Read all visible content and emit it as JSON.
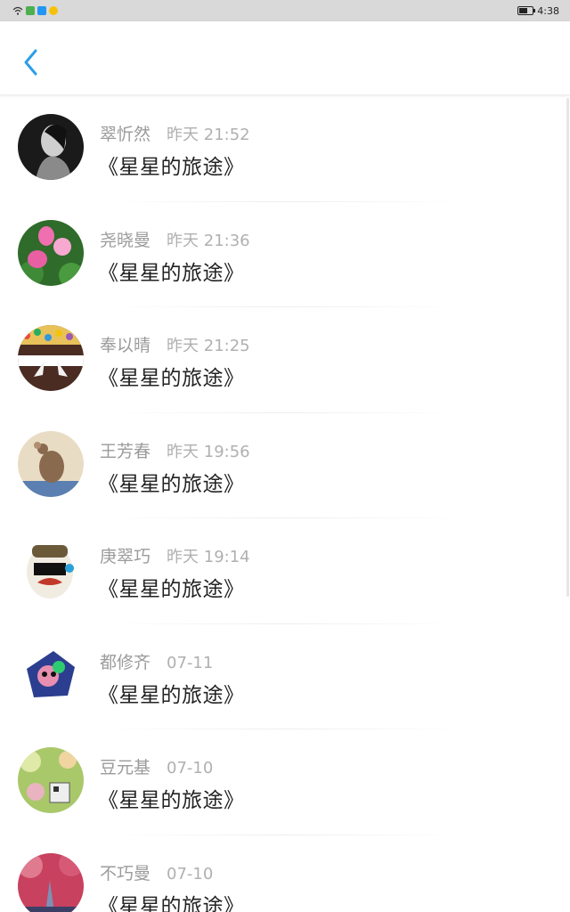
{
  "status_bar": {
    "time": "4:38",
    "icons": [
      "wifi-icon",
      "app-notification-icon",
      "app-notification-icon",
      "app-notification-icon"
    ],
    "battery_icon": "battery-icon"
  },
  "header": {
    "back_icon": "chevron-left-icon",
    "accent_color": "#2b9ee8"
  },
  "list": [
    {
      "name": "翠忻然",
      "time": "昨天 21:52",
      "title": "《星星的旅途》",
      "avatar": "woman-bw-photo"
    },
    {
      "name": "尧晓曼",
      "time": "昨天 21:36",
      "title": "《星星的旅途》",
      "avatar": "lotus-flowers"
    },
    {
      "name": "奉以晴",
      "time": "昨天 21:25",
      "title": "《星星的旅途》",
      "avatar": "candy-cake"
    },
    {
      "name": "王芳春",
      "time": "昨天 19:56",
      "title": "《星星的旅途》",
      "avatar": "mouse-figure"
    },
    {
      "name": "庚翠巧",
      "time": "昨天 19:14",
      "title": "《星星的旅途》",
      "avatar": "egg-character"
    },
    {
      "name": "都修齐",
      "time": "07-11",
      "title": "《星星的旅途》",
      "avatar": "cartoon-sticker"
    },
    {
      "name": "豆元基",
      "time": "07-10",
      "title": "《星星的旅途》",
      "avatar": "bokeh-toy"
    },
    {
      "name": "不巧曼",
      "time": "07-10",
      "title": "《星星的旅途》",
      "avatar": "cherry-blossom-road"
    }
  ]
}
